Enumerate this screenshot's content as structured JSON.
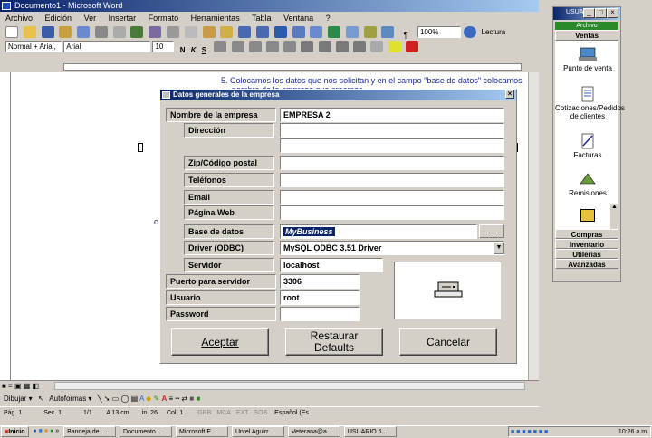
{
  "word": {
    "title": "Documento1 - Microsoft Word",
    "menu": [
      "Archivo",
      "Edición",
      "Ver",
      "Insertar",
      "Formato",
      "Herramientas",
      "Tabla",
      "Ventana",
      "?"
    ],
    "style_box": "Normal + Arial,",
    "font_box": "Arial",
    "size_box": "10",
    "zoom": "100%",
    "reading": "Lectura",
    "doc_line1": "5.   Colocamos los datos que nos solicitan y en el campo \"base de datos\" colocamos el",
    "doc_line2": "nombre de la empresa que creamos",
    "draw_menu": "Dibujar",
    "autoshapes": "Autoformas",
    "status": {
      "page": "Pág. 1",
      "section": "Sec. 1",
      "pages": "1/1",
      "at": "A 13 cm",
      "line": "Lín. 26",
      "col": "Col. 1",
      "grb": "GRB",
      "mca": "MCA",
      "ext": "EXT",
      "sob": "SOB",
      "lang": "Español (Es"
    }
  },
  "dialog": {
    "title": "Datos generales de la empresa",
    "fields": [
      {
        "label": "Nombre de la empresa",
        "value": "EMPRESA 2"
      },
      {
        "label": "Dirección",
        "value": ""
      },
      {
        "label": "",
        "value": ""
      },
      {
        "label": "Zip/Código postal",
        "value": ""
      },
      {
        "label": "Teléfonos",
        "value": ""
      },
      {
        "label": "Email",
        "value": ""
      },
      {
        "label": "Página Web",
        "value": ""
      },
      {
        "label": "Base de datos",
        "value": "MyBusiness"
      },
      {
        "label": "Driver (ODBC)",
        "value": "MySQL ODBC 3.51 Driver"
      },
      {
        "label": "Servidor",
        "value": "localhost"
      },
      {
        "label": "Puerto para servidor",
        "value": "3306"
      },
      {
        "label": "Usuario",
        "value": "root"
      },
      {
        "label": "Password",
        "value": ""
      }
    ],
    "browse_label": "...",
    "btn_accept": "Aceptar",
    "btn_restore_1": "Restaurar",
    "btn_restore_2": "Defaults",
    "btn_cancel": "Cancelar"
  },
  "panel": {
    "user": "USUARIO",
    "file": "Archivo",
    "section": "Ventas",
    "items": [
      "Punto de venta",
      "Cotizaciones/Pedidos de clientes",
      "Facturas",
      "Remisiones"
    ],
    "bottom": [
      "Compras",
      "Inventario",
      "Utilerias",
      "Avanzadas"
    ]
  },
  "taskbar": {
    "start": "Inicio",
    "tasks": [
      "Bandeja de ...",
      "Documento...",
      "Microsoft E...",
      "Untel Aguirr...",
      "Veterana@a...",
      "USUARIO 5..."
    ],
    "clock": "10:26 a.m."
  }
}
